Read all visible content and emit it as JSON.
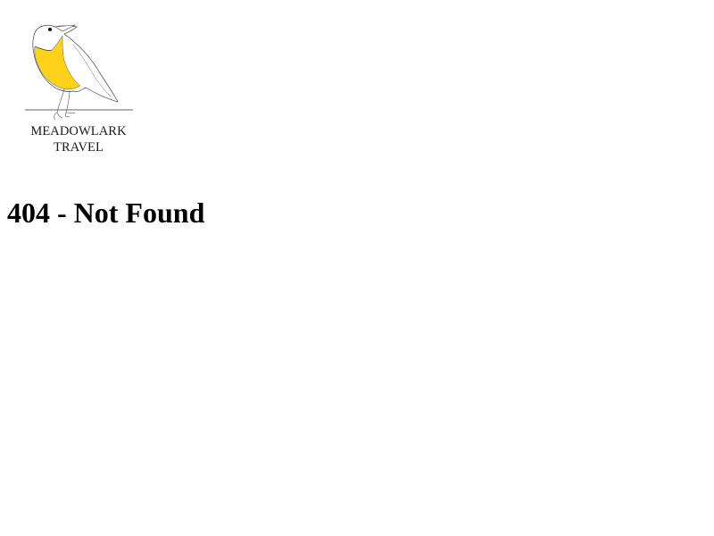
{
  "logo": {
    "icon": "meadowlark-bird-icon",
    "line1": "MEADOWLARK",
    "line2": "TRAVEL",
    "accent_color": "#FFD21A"
  },
  "error": {
    "heading": "404 - Not Found"
  }
}
